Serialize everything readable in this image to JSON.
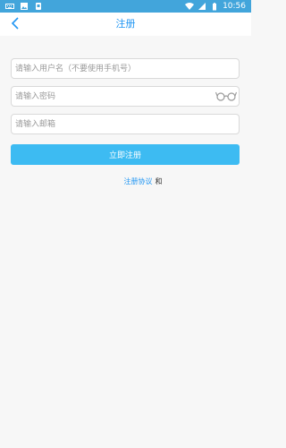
{
  "status_bar": {
    "time": "10:56",
    "left_icons": [
      "keyboard-icon",
      "image-icon",
      "android-icon"
    ],
    "right_icons": [
      "wifi-icon",
      "signal-icon",
      "battery-icon"
    ],
    "background": "#42a5db"
  },
  "header": {
    "title": "注册",
    "back_icon": "chevron-left-icon",
    "accent": "#2196f3"
  },
  "form": {
    "username_placeholder": "请输入用户名（不要使用手机号）",
    "password_placeholder": "请输入密码",
    "email_placeholder": "请输入邮箱",
    "password_toggle_icon": "glasses-icon",
    "submit_label": "立即注册",
    "submit_color": "#3dbbf2"
  },
  "agreement": {
    "link_text": "注册协议",
    "and_text": "和"
  }
}
